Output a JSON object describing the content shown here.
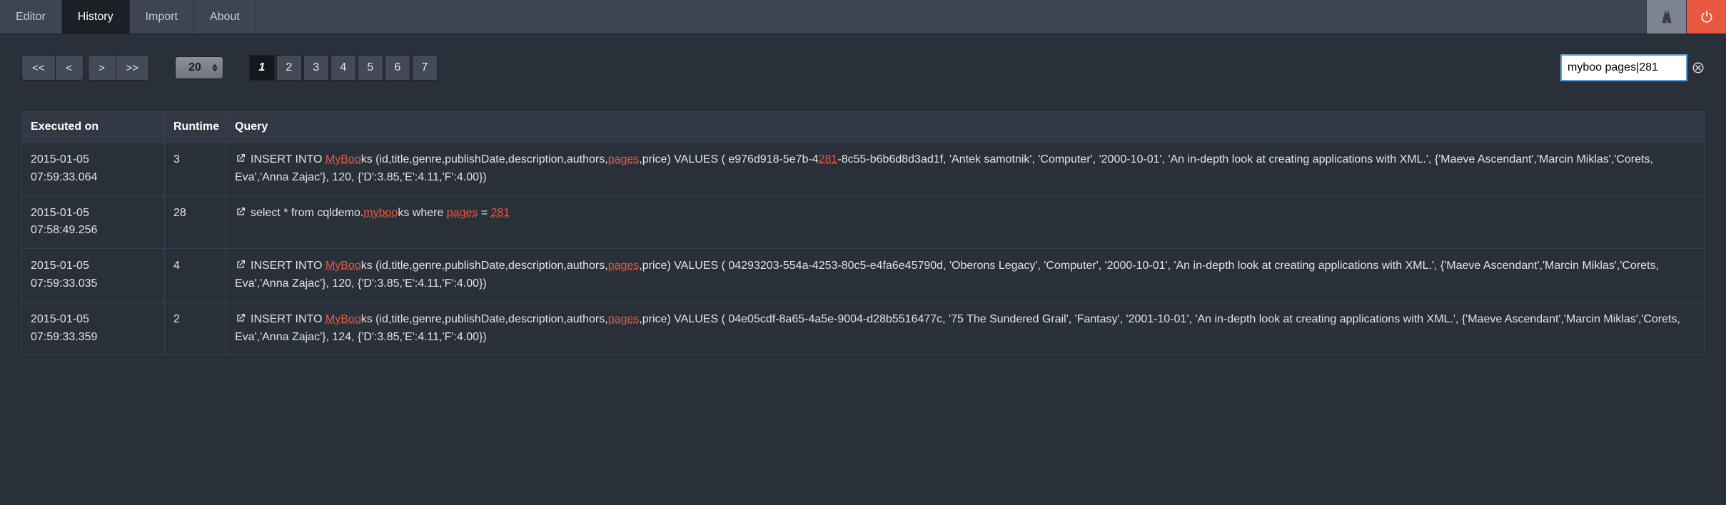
{
  "tabs": [
    {
      "label": "Editor",
      "active": false
    },
    {
      "label": "History",
      "active": true
    },
    {
      "label": "Import",
      "active": false
    },
    {
      "label": "About",
      "active": false
    }
  ],
  "nav": {
    "first": "<<",
    "prev": "<",
    "next": ">",
    "last": ">>"
  },
  "page_size": "20",
  "pages": [
    "1",
    "2",
    "3",
    "4",
    "5",
    "6",
    "7"
  ],
  "active_page": "1",
  "search_value": "myboo pages|281",
  "columns": {
    "executed_on": "Executed on",
    "runtime": "Runtime",
    "query": "Query"
  },
  "highlight_terms": [
    "myboo",
    "pages",
    "281",
    "MyBoo"
  ],
  "rows": [
    {
      "executed_on": "2015-01-05 07:59:33.064",
      "runtime": "3",
      "query": "INSERT INTO MyBooks (id,title,genre,publishDate,description,authors,pages,price) VALUES ( e976d918-5e7b-4281-8c55-b6b6d8d3ad1f, 'Antek samotnik', 'Computer', '2000-10-01', 'An in-depth look at creating applications with XML.', {'Maeve Ascendant','Marcin Miklas','Corets, Eva','Anna Zajac'}, 120, {'D':3.85,'E':4.11,'F':4.00})"
    },
    {
      "executed_on": "2015-01-05 07:58:49.256",
      "runtime": "28",
      "query": "select * from cqldemo.mybooks where pages = 281"
    },
    {
      "executed_on": "2015-01-05 07:59:33.035",
      "runtime": "4",
      "query": "INSERT INTO MyBooks (id,title,genre,publishDate,description,authors,pages,price) VALUES ( 04293203-554a-4253-80c5-e4fa6e45790d, 'Oberons Legacy', 'Computer', '2000-10-01', 'An in-depth look at creating applications with XML.', {'Maeve Ascendant','Marcin Miklas','Corets, Eva','Anna Zajac'}, 120, {'D':3.85,'E':4.11,'F':4.00})"
    },
    {
      "executed_on": "2015-01-05 07:59:33.359",
      "runtime": "2",
      "query": "INSERT INTO MyBooks (id,title,genre,publishDate,description,authors,pages,price) VALUES ( 04e05cdf-8a65-4a5e-9004-d28b5516477c, '75 The Sundered Grail', 'Fantasy', '2001-10-01', 'An in-depth look at creating applications with XML.', {'Maeve Ascendant','Marcin Miklas','Corets, Eva','Anna Zajac'}, 124, {'D':3.85,'E':4.11,'F':4.00})"
    }
  ]
}
